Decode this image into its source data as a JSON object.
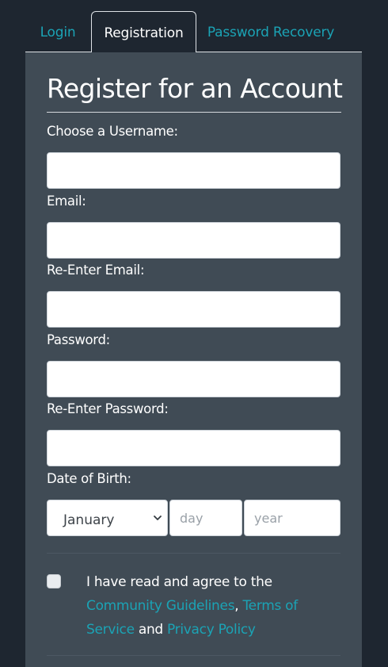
{
  "tabs": {
    "login": "Login",
    "registration": "Registration",
    "recovery": "Password Recovery"
  },
  "form": {
    "title": "Register for an Account",
    "username_label": "Choose a Username:",
    "username_value": "",
    "email_label": "Email:",
    "email_value": "",
    "reemail_label": "Re-Enter Email:",
    "reemail_value": "",
    "password_label": "Password:",
    "password_value": "",
    "repassword_label": "Re-Enter Password:",
    "repassword_value": "",
    "dob_label": "Date of Birth:",
    "dob_month": "January",
    "dob_day_placeholder": "day",
    "dob_year_placeholder": "year",
    "agree_prefix": "I have read and agree to the ",
    "link_guidelines": "Community Guidelines",
    "comma": ", ",
    "link_terms": "Terms of Service",
    "and_text": " and ",
    "link_privacy": "Privacy Policy",
    "agree_checked": false
  },
  "colors": {
    "background": "#1e2630",
    "panel": "#404b55",
    "accent": "#1ba3b5"
  }
}
